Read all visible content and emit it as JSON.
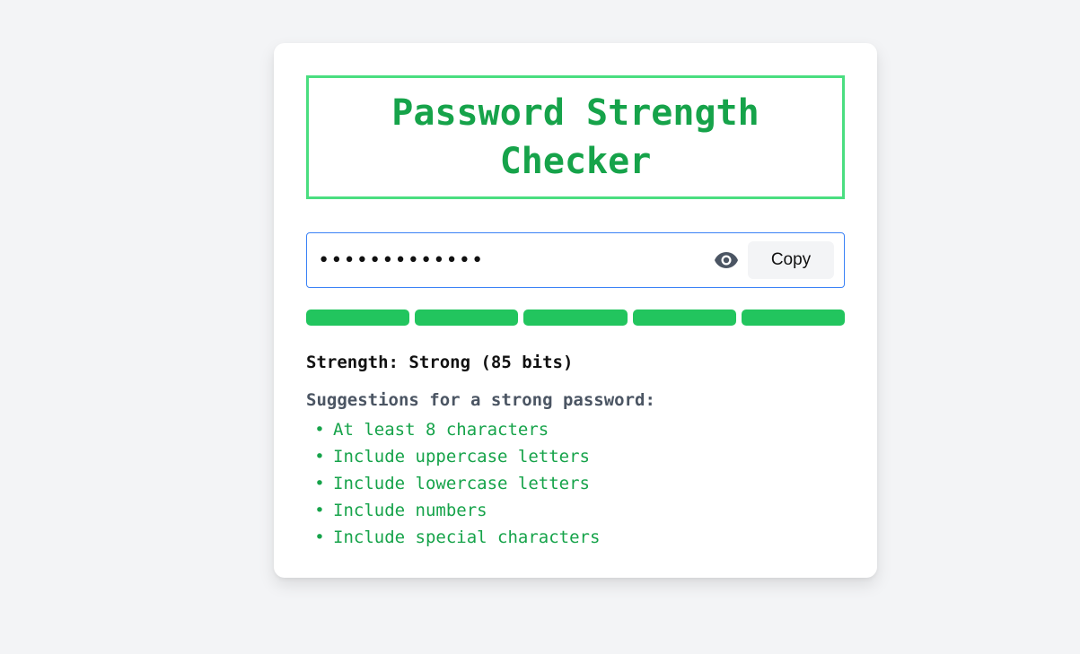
{
  "title": "Password Strength Checker",
  "password": {
    "masked_value": "•••••••••••••",
    "eye_icon": "eye-icon",
    "copy_label": "Copy"
  },
  "meter": {
    "segments_filled": 5,
    "segments_total": 5,
    "fill_color": "#22c55e"
  },
  "strength_text": "Strength: Strong (85 bits)",
  "suggestions": {
    "heading": "Suggestions for a strong password:",
    "items": [
      "At least 8 characters",
      "Include uppercase letters",
      "Include lowercase letters",
      "Include numbers",
      "Include special characters"
    ]
  },
  "colors": {
    "accent": "#16a34a",
    "title_border": "#4ade80",
    "input_border": "#3b82f6"
  }
}
